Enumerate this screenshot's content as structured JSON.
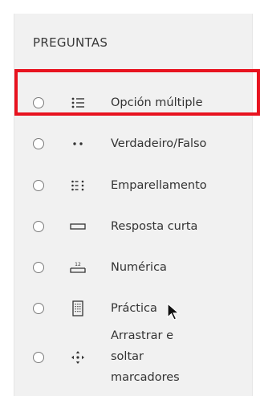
{
  "panel": {
    "title": "PREGUNTAS"
  },
  "question_types": [
    {
      "label": "Opción múltiple",
      "icon": "multiple-choice-icon"
    },
    {
      "label": "Verdadeiro/Falso",
      "icon": "true-false-icon"
    },
    {
      "label": "Emparellamento",
      "icon": "matching-icon"
    },
    {
      "label": "Resposta curta",
      "icon": "short-answer-icon"
    },
    {
      "label": "Numérica",
      "icon": "numerical-icon",
      "icon_text": "12"
    },
    {
      "label": "Práctica",
      "icon": "practice-icon"
    },
    {
      "label_lines": [
        "Arrastrar e",
        "soltar",
        "marcadores"
      ],
      "icon": "drag-drop-markers-icon"
    }
  ],
  "colors": {
    "panel_bg": "#f1f1f1",
    "highlight": "#e8131f",
    "text": "#333333"
  }
}
